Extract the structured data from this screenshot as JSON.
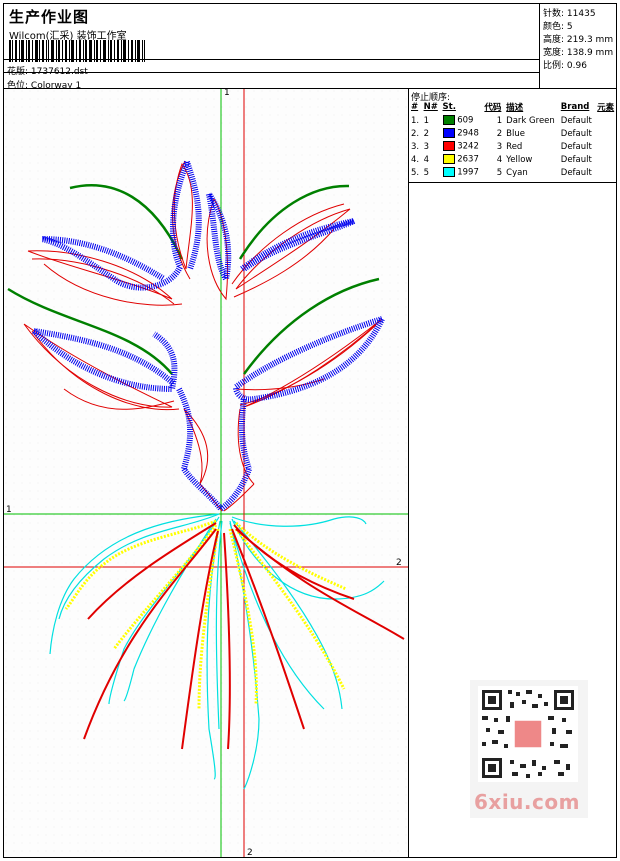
{
  "header": {
    "title": "生产作业图",
    "company": "Wilcom(汇采) 装饰工作室",
    "design_label": "花版:",
    "design_value": "1737612.dst",
    "colorway_label": "色位:",
    "colorway_value": "Colorway 1"
  },
  "stats": {
    "stitches_label": "针数:",
    "stitches_value": "11435",
    "colors_label": "颜色:",
    "colors_value": "5",
    "height_label": "高度:",
    "height_value": "219.3 mm",
    "width_label": "宽度:",
    "width_value": "138.9 mm",
    "scale_label": "比例:",
    "scale_value": "0.96"
  },
  "stop_sequence": {
    "title": "停止顺序:",
    "columns": [
      "#",
      "N#",
      "St.",
      "代码",
      "描述",
      "Brand",
      "元素"
    ],
    "rows": [
      {
        "idx": "1.",
        "n": "1",
        "color": "#008000",
        "st": "609",
        "code": "1",
        "desc": "Dark Green",
        "brand": "Default"
      },
      {
        "idx": "2.",
        "n": "2",
        "color": "#0000ff",
        "st": "2948",
        "code": "2",
        "desc": "Blue",
        "brand": "Default"
      },
      {
        "idx": "3.",
        "n": "3",
        "color": "#ff0000",
        "st": "3242",
        "code": "3",
        "desc": "Red",
        "brand": "Default"
      },
      {
        "idx": "4.",
        "n": "4",
        "color": "#ffff00",
        "st": "2637",
        "code": "4",
        "desc": "Yellow",
        "brand": "Default"
      },
      {
        "idx": "5.",
        "n": "5",
        "color": "#00ffff",
        "st": "1997",
        "code": "5",
        "desc": "Cyan",
        "brand": "Default"
      }
    ]
  },
  "axes": {
    "label_top_green": "1",
    "label_left_green": "1",
    "label_right_red": "2",
    "label_bottom_red": "2"
  },
  "watermark": "6xiu.com"
}
